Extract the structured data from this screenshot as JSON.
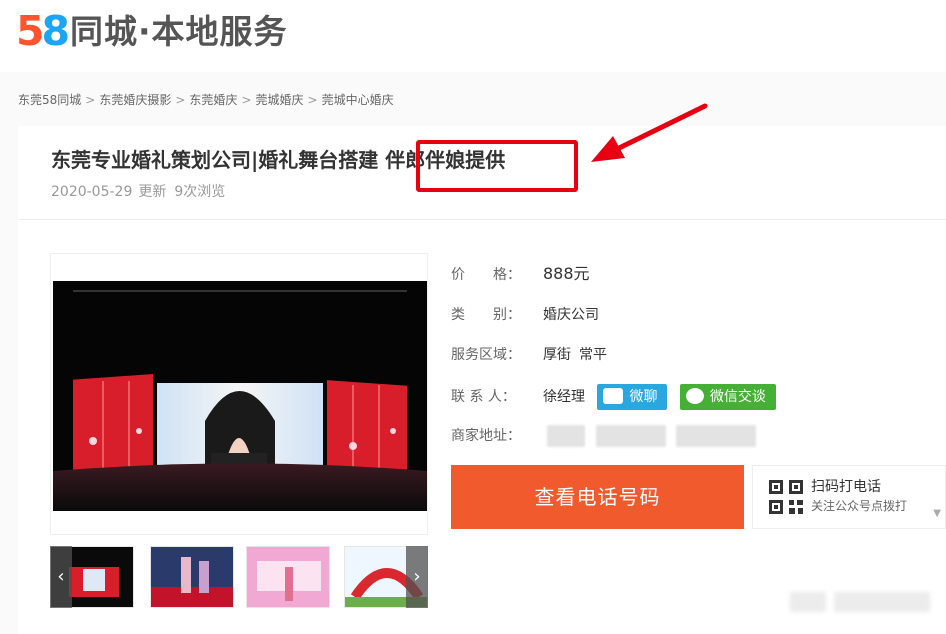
{
  "header": {
    "logo_num_5": "5",
    "logo_num_8": "8",
    "logo_text": "同城·本地服务"
  },
  "breadcrumb": [
    "东莞58同城",
    "东莞婚庆摄影",
    "东莞婚庆",
    "莞城婚庆",
    "莞城中心婚庆"
  ],
  "breadcrumb_sep": ">",
  "listing": {
    "title_main": "东莞专业婚礼策划公司|婚礼舞台搭建 ",
    "title_highlight": "伴郎伴娘提供",
    "date": "2020-05-29",
    "updated": "更新",
    "views": "9次浏览"
  },
  "info": {
    "price_label": "价　　格：",
    "price_value": "888元",
    "category_label": "类　　别：",
    "category_value": "婚庆公司",
    "area_label": "服务区域：",
    "area_value_1": "厚街",
    "area_value_2": "常平",
    "contact_label": "联 系 人：",
    "contact_value": "徐经理",
    "chat_label": "微聊",
    "wechat_label": "微信交谈",
    "address_label": "商家地址："
  },
  "actions": {
    "call_label": "查看电话号码",
    "qr_title": "扫码打电话",
    "qr_sub": "关注公众号点拨打",
    "thumb_prev": "‹",
    "thumb_next": "›"
  },
  "colors": {
    "brand_orange": "#ff552e",
    "call_orange": "#f15a2c",
    "chat_blue": "#29a8e0",
    "wechat_green": "#45b035",
    "annotation_red": "#e60012"
  }
}
